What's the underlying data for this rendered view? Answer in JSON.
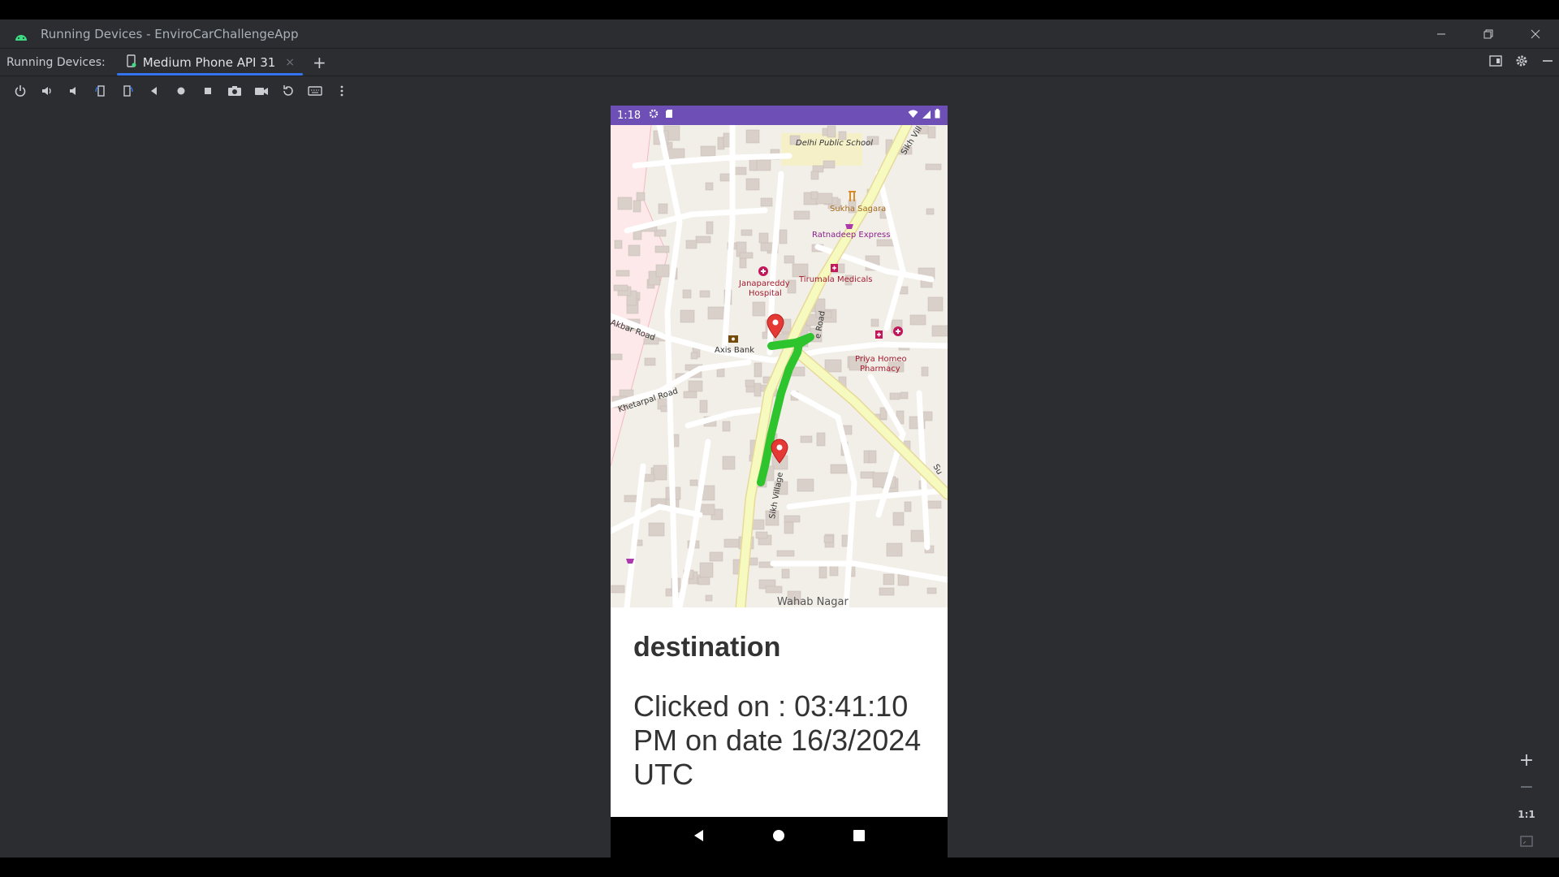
{
  "window": {
    "title": "Running Devices - EnviroCarChallengeApp"
  },
  "tabbar": {
    "label": "Running Devices:",
    "tabs": [
      {
        "label": "Medium Phone API 31",
        "close": "×"
      }
    ],
    "add": "+"
  },
  "toolbar": {
    "icons": [
      "power-icon",
      "volume-up-icon",
      "volume-down-icon",
      "rotate-left-icon",
      "rotate-right-icon",
      "back-icon",
      "home-icon",
      "overview-icon",
      "screenshot-icon",
      "screen-record-icon",
      "reset-icon",
      "keyboard-icon",
      "more-icon"
    ]
  },
  "phone": {
    "status": {
      "time": "1:18"
    },
    "map": {
      "labels": {
        "school": "Delhi Public School",
        "sukha": "Sukha Sagara",
        "ratnadeep": "Ratnadeep Express",
        "tirumala": "Tirumala Medicals",
        "jana1": "Janapareddy",
        "jana2": "Hospital",
        "akbar": "Akbar Road",
        "axis": "Axis Bank",
        "priya1": "Priya Homeo",
        "priya2": "Pharmacy",
        "khetarpal": "Khetarpal Road",
        "sikh": "Sikh Village",
        "wahab": "Wahab Nagar",
        "siki": "Sikh Vill",
        "eroad": "e Road",
        "su": "Su"
      },
      "colors": {
        "route": "#2ec42e",
        "marker": "#e53935",
        "primary_road": "#f7fabf"
      }
    },
    "info": {
      "title": "destination",
      "clicked": "Clicked on : 03:41:10 PM on date 16/3/2024 UTC"
    }
  },
  "zoom": {
    "plus": "+",
    "minus": "−",
    "one_to_one": "1:1"
  }
}
